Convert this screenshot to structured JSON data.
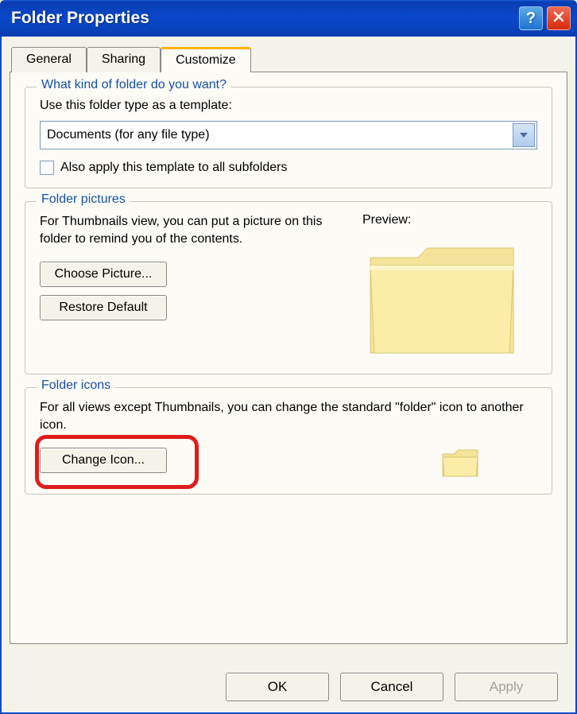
{
  "window": {
    "title": "Folder Properties"
  },
  "tabs": {
    "general": "General",
    "sharing": "Sharing",
    "customize": "Customize"
  },
  "folderType": {
    "legend": "What kind of folder do you want?",
    "label": "Use this folder type as a template:",
    "selected": "Documents (for any file type)",
    "checkbox": "Also apply this template to all subfolders"
  },
  "pictures": {
    "legend": "Folder pictures",
    "desc": "For Thumbnails view, you can put a picture on this folder to remind you of the contents.",
    "choose": "Choose Picture...",
    "restore": "Restore Default",
    "preview": "Preview:"
  },
  "icons": {
    "legend": "Folder icons",
    "desc": "For all views except Thumbnails, you can change the standard \"folder\" icon to another icon.",
    "change": "Change Icon..."
  },
  "footer": {
    "ok": "OK",
    "cancel": "Cancel",
    "apply": "Apply"
  }
}
